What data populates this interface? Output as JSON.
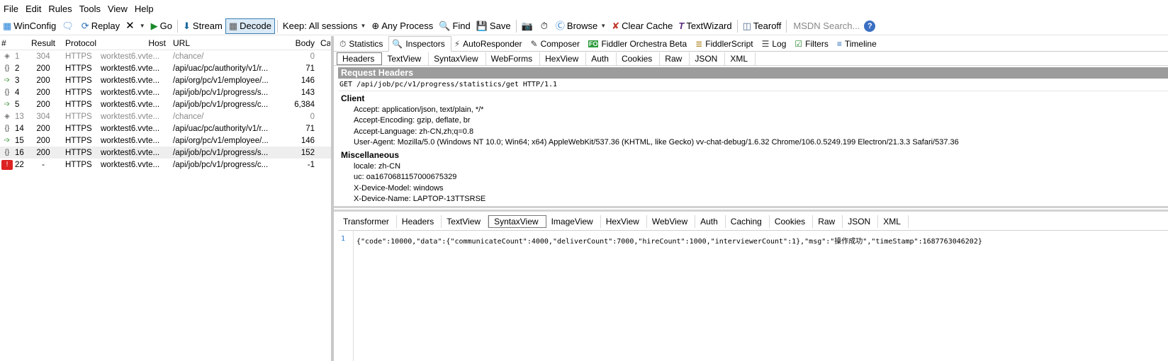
{
  "menu": [
    {
      "label": "File"
    },
    {
      "label": "Edit"
    },
    {
      "label": "Rules"
    },
    {
      "label": "Tools"
    },
    {
      "label": "View"
    },
    {
      "label": "Help"
    }
  ],
  "toolbar": {
    "winconfig": "WinConfig",
    "replay": "Replay",
    "go": "Go",
    "stream": "Stream",
    "decode": "Decode",
    "keep": "Keep: All sessions",
    "any_process": "Any Process",
    "find": "Find",
    "save": "Save",
    "browse": "Browse",
    "clear_cache": "Clear Cache",
    "textwizard": "TextWizard",
    "tearoff": "Tearoff",
    "msdn": "MSDN Search..."
  },
  "sessions": {
    "columns": {
      "num": "#",
      "result": "Result",
      "protocol": "Protocol",
      "host": "Host",
      "url": "URL",
      "body": "Body",
      "caching": "Ca"
    },
    "rows": [
      {
        "num": "1",
        "result": "304",
        "protocol": "HTTPS",
        "host": "worktest6.vvte...",
        "url": "/chance/",
        "body": "0",
        "icon": "diamond-icon",
        "dim": true
      },
      {
        "num": "2",
        "result": "200",
        "protocol": "HTTPS",
        "host": "worktest6.vvte...",
        "url": "/api/uac/pc/authority/v1/r...",
        "body": "71",
        "icon": "json-icon"
      },
      {
        "num": "3",
        "result": "200",
        "protocol": "HTTPS",
        "host": "worktest6.vvte...",
        "url": "/api/org/pc/v1/employee/...",
        "body": "146",
        "icon": "post-arrow-icon"
      },
      {
        "num": "4",
        "result": "200",
        "protocol": "HTTPS",
        "host": "worktest6.vvte...",
        "url": "/api/job/pc/v1/progress/s...",
        "body": "143",
        "icon": "json-icon"
      },
      {
        "num": "5",
        "result": "200",
        "protocol": "HTTPS",
        "host": "worktest6.vvte...",
        "url": "/api/job/pc/v1/progress/c...",
        "body": "6,384",
        "icon": "post-arrow-icon"
      },
      {
        "num": "13",
        "result": "304",
        "protocol": "HTTPS",
        "host": "worktest6.vvte...",
        "url": "/chance/",
        "body": "0",
        "icon": "diamond-icon",
        "dim": true
      },
      {
        "num": "14",
        "result": "200",
        "protocol": "HTTPS",
        "host": "worktest6.vvte...",
        "url": "/api/uac/pc/authority/v1/r...",
        "body": "71",
        "icon": "json-icon"
      },
      {
        "num": "15",
        "result": "200",
        "protocol": "HTTPS",
        "host": "worktest6.vvte...",
        "url": "/api/org/pc/v1/employee/...",
        "body": "146",
        "icon": "post-arrow-icon"
      },
      {
        "num": "16",
        "result": "200",
        "protocol": "HTTPS",
        "host": "worktest6.vvte...",
        "url": "/api/job/pc/v1/progress/s...",
        "body": "152",
        "icon": "json-icon",
        "selected": true
      },
      {
        "num": "22",
        "result": "-",
        "protocol": "HTTPS",
        "host": "worktest6.vvte...",
        "url": "/api/job/pc/v1/progress/c...",
        "body": "-1",
        "icon": "error-icon"
      }
    ]
  },
  "inspector_tabs": [
    {
      "label": "Statistics",
      "icon": "stopwatch-icon"
    },
    {
      "label": "Inspectors",
      "icon": "magnifier-icon",
      "active": true
    },
    {
      "label": "AutoResponder",
      "icon": "lightning-icon"
    },
    {
      "label": "Composer",
      "icon": "pencil-icon"
    },
    {
      "label": "Fiddler Orchestra Beta",
      "icon": "fo-icon"
    },
    {
      "label": "FiddlerScript",
      "icon": "script-icon"
    },
    {
      "label": "Log",
      "icon": "log-icon"
    },
    {
      "label": "Filters",
      "icon": "checkbox-icon"
    },
    {
      "label": "Timeline",
      "icon": "timeline-icon"
    }
  ],
  "request_tabs": [
    "Headers",
    "TextView",
    "SyntaxView",
    "WebForms",
    "HexView",
    "Auth",
    "Cookies",
    "Raw",
    "JSON",
    "XML"
  ],
  "request": {
    "title": "Request Headers",
    "line": "GET /api/job/pc/v1/progress/statistics/get HTTP/1.1",
    "groups": [
      {
        "name": "Client",
        "headers": [
          "Accept: application/json, text/plain, */*",
          "Accept-Encoding: gzip, deflate, br",
          "Accept-Language: zh-CN,zh;q=0.8",
          "User-Agent: Mozilla/5.0 (Windows NT 10.0; Win64; x64) AppleWebKit/537.36 (KHTML, like Gecko) vv-chat-debug/1.6.32 Chrome/106.0.5249.199 Electron/21.3.3 Safari/537.36"
        ]
      },
      {
        "name": "Miscellaneous",
        "headers": [
          "locale: zh-CN",
          "uc: oa1670681157000675329",
          "X-Device-Model: windows",
          "X-Device-Name: LAPTOP-13TTSRSE"
        ]
      }
    ]
  },
  "response_tabs": [
    "Transformer",
    "Headers",
    "TextView",
    "SyntaxView",
    "ImageView",
    "HexView",
    "WebView",
    "Auth",
    "Caching",
    "Cookies",
    "Raw",
    "JSON",
    "XML"
  ],
  "response": {
    "line_number": "1",
    "body": "{\"code\":10000,\"data\":{\"communicateCount\":4000,\"deliverCount\":7000,\"hireCount\":1000,\"interviewerCount\":1},\"msg\":\"操作成功\",\"timeStamp\":1687763046202}"
  }
}
